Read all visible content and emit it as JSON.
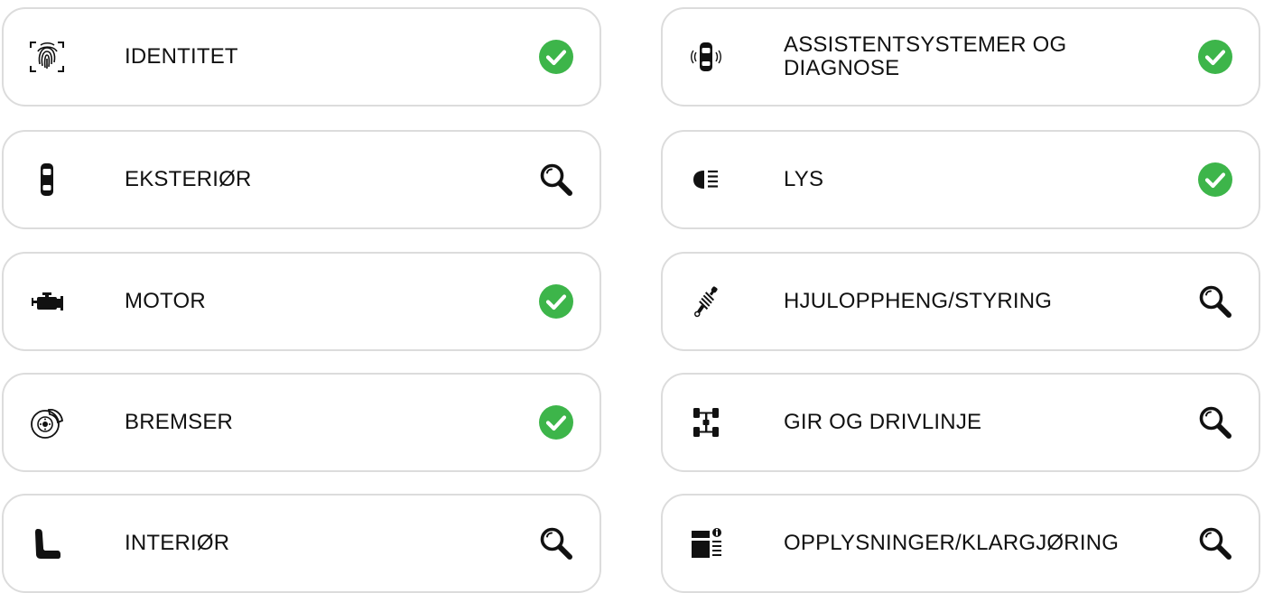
{
  "accent_colors": {
    "ok_green": "#3db54a",
    "icon_dark": "#111111"
  },
  "categories": [
    {
      "label": "IDENTITET",
      "icon": "fingerprint-icon",
      "status": "ok"
    },
    {
      "label": "ASSISTENTSYSTEMER OG DIAGNOSE",
      "icon": "car-sensors-icon",
      "status": "ok"
    },
    {
      "label": "EKSTERIØR",
      "icon": "car-top-icon",
      "status": "inspect"
    },
    {
      "label": "LYS",
      "icon": "headlight-icon",
      "status": "ok"
    },
    {
      "label": "MOTOR",
      "icon": "engine-icon",
      "status": "ok"
    },
    {
      "label": "HJULOPPHENG/STYRING",
      "icon": "shock-absorber-icon",
      "status": "inspect"
    },
    {
      "label": "BREMSER",
      "icon": "brake-disc-icon",
      "status": "ok"
    },
    {
      "label": "GIR OG DRIVLINJE",
      "icon": "drivetrain-icon",
      "status": "inspect"
    },
    {
      "label": "INTERIØR",
      "icon": "seat-icon",
      "status": "inspect"
    },
    {
      "label": "OPPLYSNINGER/KLARGJØRING",
      "icon": "info-document-icon",
      "status": "inspect"
    }
  ]
}
